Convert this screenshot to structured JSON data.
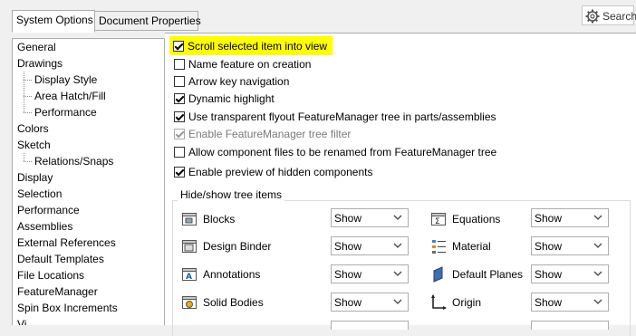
{
  "tabs": [
    {
      "label": "System Options",
      "active": true
    },
    {
      "label": "Document Properties",
      "active": false
    }
  ],
  "search": {
    "label": "Search",
    "icon": "gear-icon"
  },
  "tree": {
    "items": [
      {
        "label": "General",
        "level": 0
      },
      {
        "label": "Drawings",
        "level": 0
      },
      {
        "label": "Display Style",
        "level": 1
      },
      {
        "label": "Area Hatch/Fill",
        "level": 1
      },
      {
        "label": "Performance",
        "level": 1
      },
      {
        "label": "Colors",
        "level": 0
      },
      {
        "label": "Sketch",
        "level": 0
      },
      {
        "label": "Relations/Snaps",
        "level": 1
      },
      {
        "label": "Display",
        "level": 0
      },
      {
        "label": "Selection",
        "level": 0
      },
      {
        "label": "Performance",
        "level": 0
      },
      {
        "label": "Assemblies",
        "level": 0
      },
      {
        "label": "External References",
        "level": 0
      },
      {
        "label": "Default Templates",
        "level": 0
      },
      {
        "label": "File Locations",
        "level": 0
      },
      {
        "label": "FeatureManager",
        "level": 0
      },
      {
        "label": "Spin Box Increments",
        "level": 0
      },
      {
        "label": "Vi",
        "level": 0
      }
    ]
  },
  "options": [
    {
      "label": "Scroll selected item into view",
      "checked": true,
      "disabled": false,
      "highlight": "#ffff00"
    },
    {
      "label": "Name feature on creation",
      "checked": false,
      "disabled": false
    },
    {
      "label": "Arrow key navigation",
      "checked": false,
      "disabled": false
    },
    {
      "label": "Dynamic highlight",
      "checked": true,
      "disabled": false
    },
    {
      "label": "Use transparent flyout FeatureManager tree in parts/assemblies",
      "checked": true,
      "disabled": false
    },
    {
      "label": "Enable FeatureManager tree filter",
      "checked": true,
      "disabled": true
    },
    {
      "label": "Allow component files to be renamed from FeatureManager tree",
      "checked": false,
      "disabled": false
    },
    {
      "label": "Enable preview of hidden components",
      "checked": true,
      "disabled": false
    }
  ],
  "hide_show": {
    "title": "Hide/show tree items",
    "left": [
      {
        "label": "Blocks",
        "icon": "blocks-icon",
        "value": "Show"
      },
      {
        "label": "Design Binder",
        "icon": "design-binder-icon",
        "value": "Show"
      },
      {
        "label": "Annotations",
        "icon": "annotations-icon",
        "value": "Show"
      },
      {
        "label": "Solid Bodies",
        "icon": "solid-bodies-icon",
        "value": "Show"
      }
    ],
    "right": [
      {
        "label": "Equations",
        "icon": "equations-icon",
        "value": "Show"
      },
      {
        "label": "Material",
        "icon": "material-icon",
        "value": "Show"
      },
      {
        "label": "Default Planes",
        "icon": "default-planes-icon",
        "value": "Show"
      },
      {
        "label": "Origin",
        "icon": "origin-icon",
        "value": "Show"
      }
    ]
  }
}
